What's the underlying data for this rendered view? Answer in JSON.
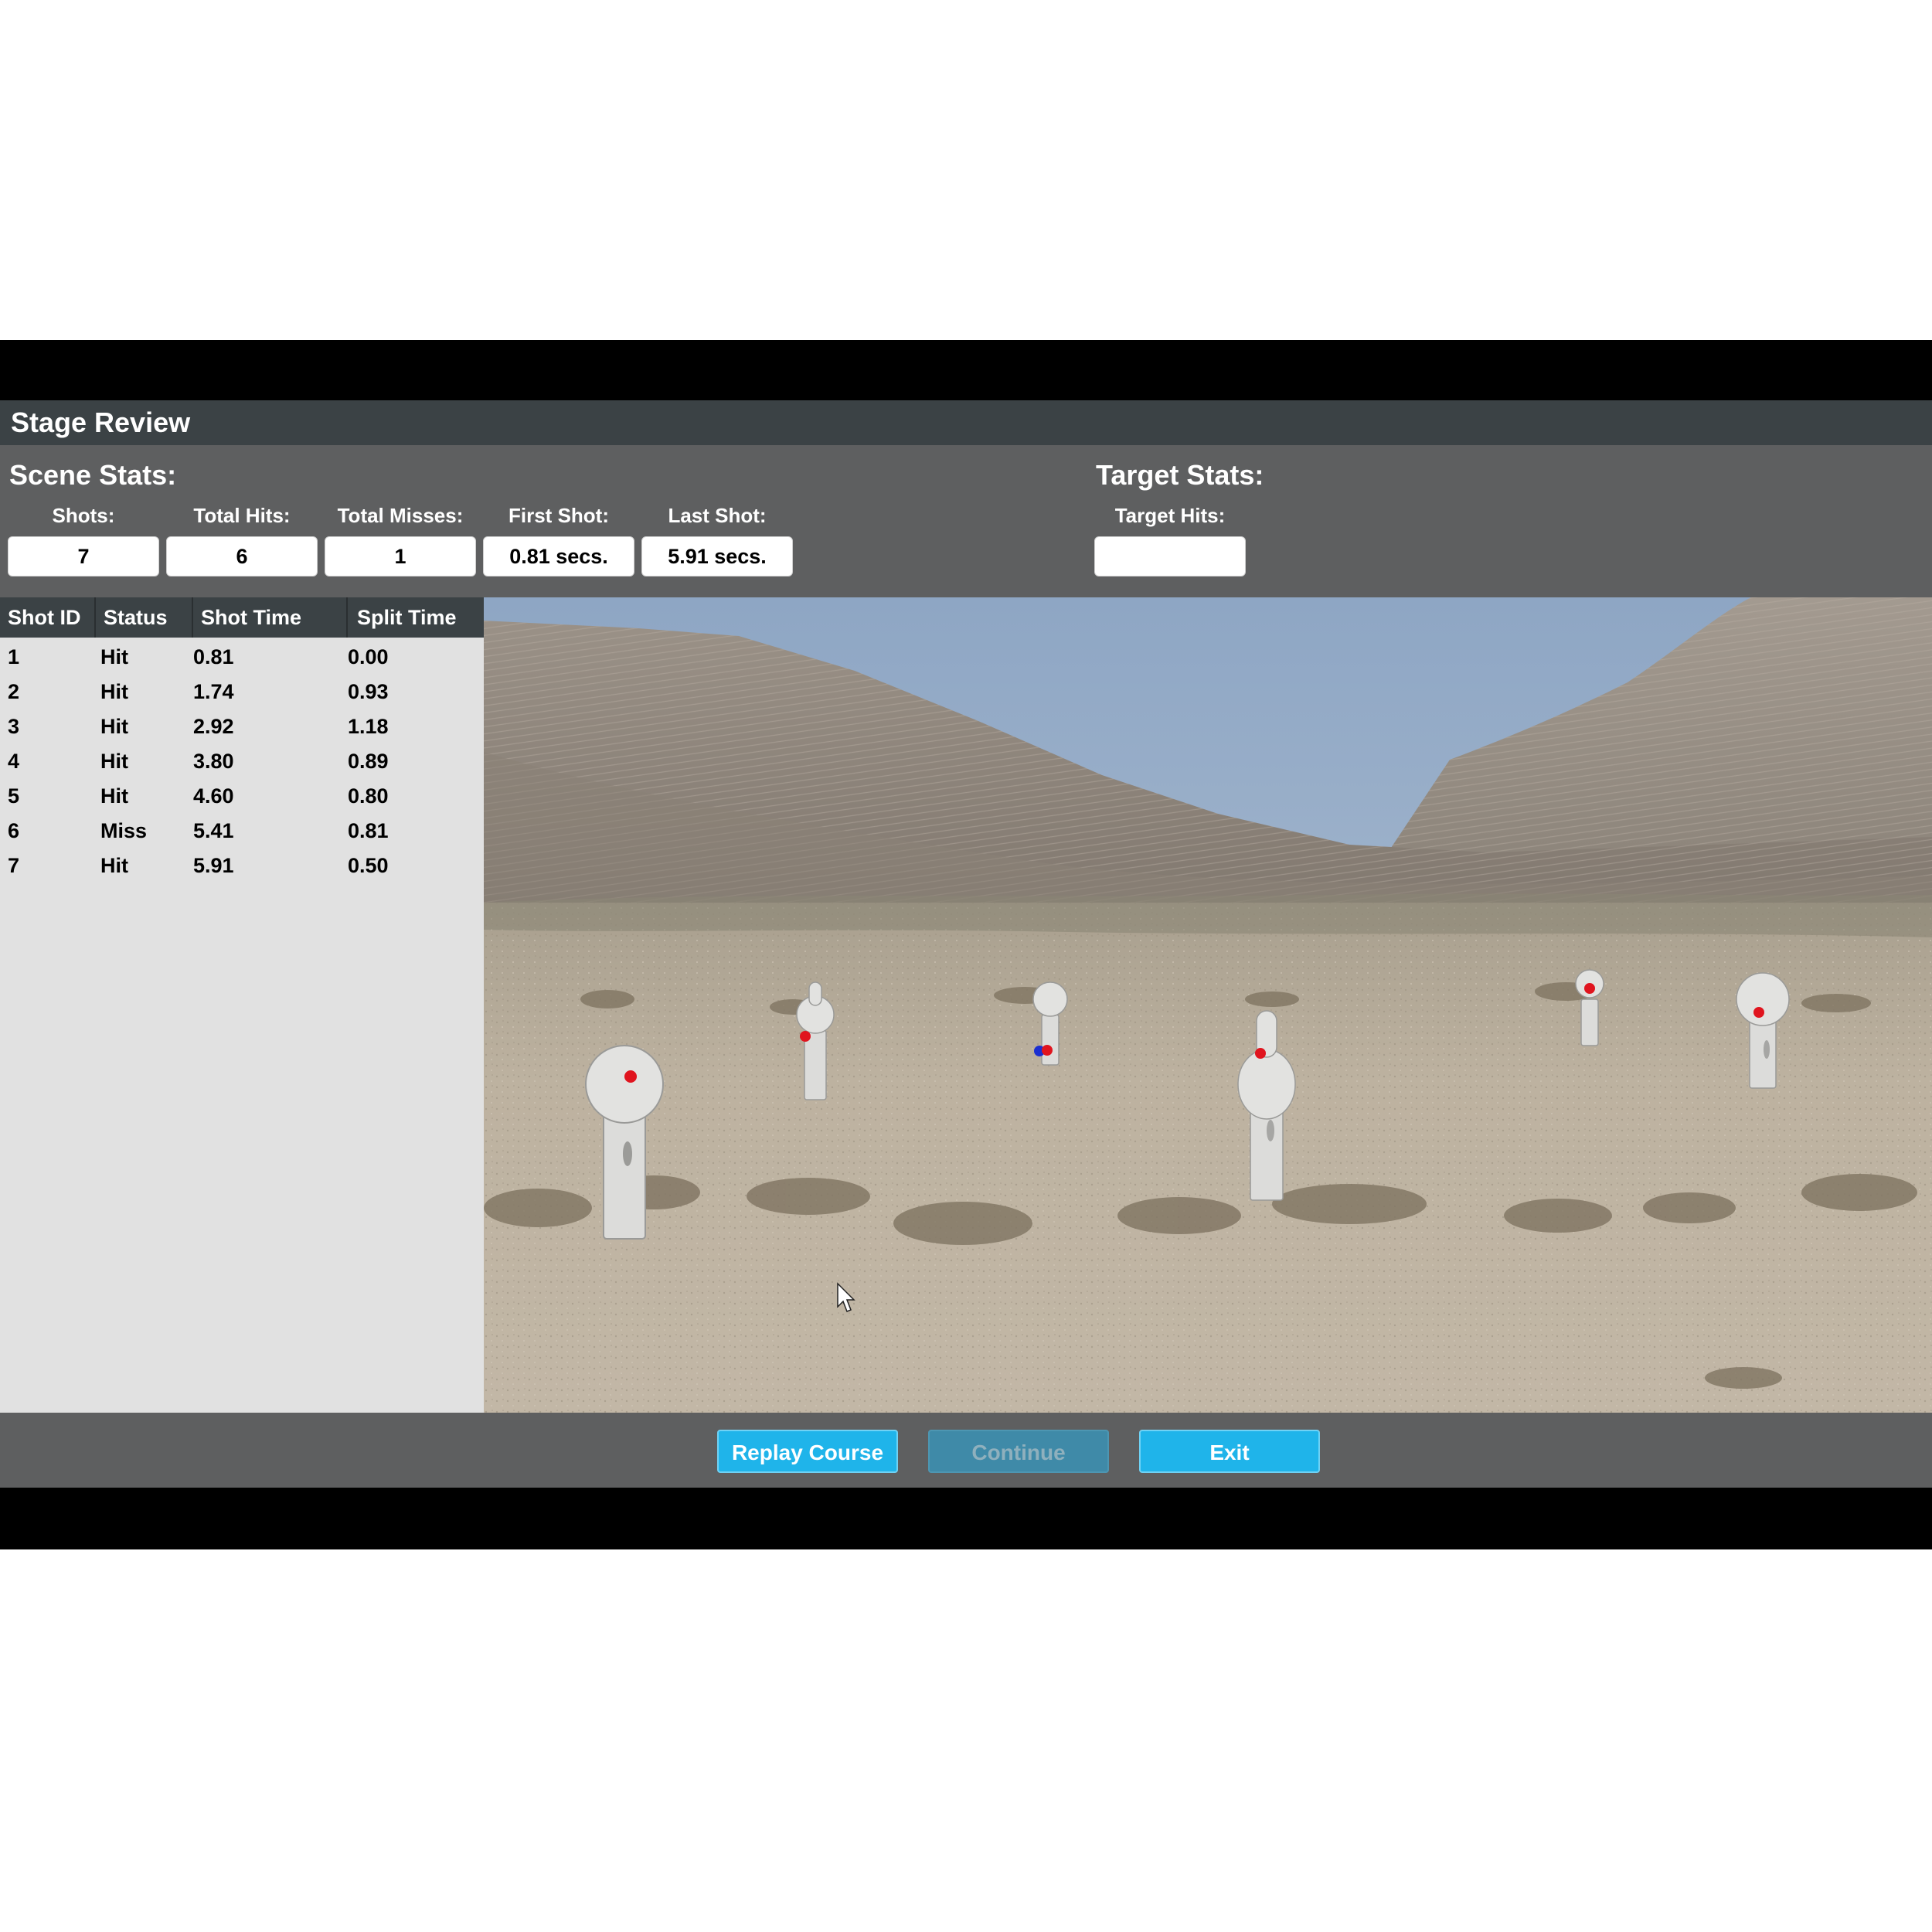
{
  "window": {
    "title": "Stage Review"
  },
  "scene_stats": {
    "title": "Scene Stats:",
    "items": [
      {
        "label": "Shots:",
        "value": "7"
      },
      {
        "label": "Total Hits:",
        "value": "6"
      },
      {
        "label": "Total Misses:",
        "value": "1"
      },
      {
        "label": "First Shot:",
        "value": "0.81 secs."
      },
      {
        "label": "Last Shot:",
        "value": "5.91 secs."
      }
    ]
  },
  "target_stats": {
    "title": "Target Stats:",
    "label": "Target Hits:",
    "value": ""
  },
  "shot_table": {
    "columns": [
      "Shot ID",
      "Status",
      "Shot Time",
      "Split Time"
    ],
    "rows": [
      [
        "1",
        "Hit",
        "0.81",
        "0.00"
      ],
      [
        "2",
        "Hit",
        "1.74",
        "0.93"
      ],
      [
        "3",
        "Hit",
        "2.92",
        "1.18"
      ],
      [
        "4",
        "Hit",
        "3.80",
        "0.89"
      ],
      [
        "5",
        "Hit",
        "4.60",
        "0.80"
      ],
      [
        "6",
        "Miss",
        "5.41",
        "0.81"
      ],
      [
        "7",
        "Hit",
        "5.91",
        "0.50"
      ]
    ]
  },
  "buttons": {
    "replay": "Replay Course",
    "continue": "Continue",
    "exit": "Exit"
  },
  "colors": {
    "hit_marker": "#e0141e",
    "miss_marker": "#1b2fd0",
    "button_accent": "#1fb4ea"
  }
}
